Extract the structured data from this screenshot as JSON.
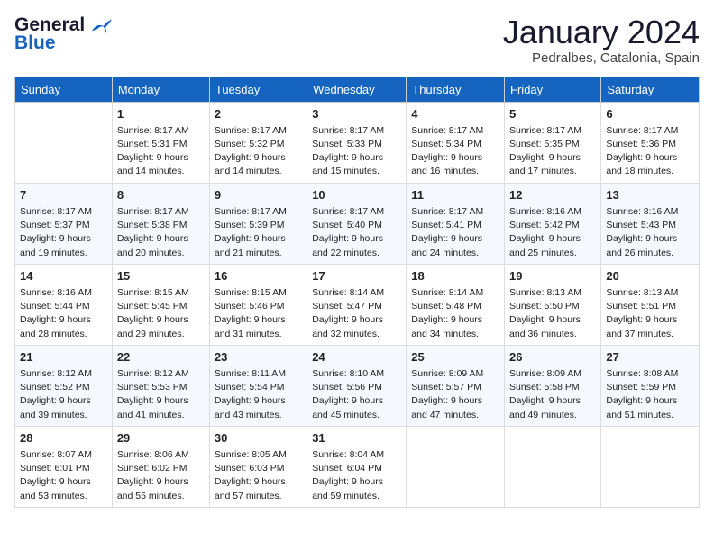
{
  "header": {
    "logo_general": "General",
    "logo_blue": "Blue",
    "month_title": "January 2024",
    "location": "Pedralbes, Catalonia, Spain"
  },
  "weekdays": [
    "Sunday",
    "Monday",
    "Tuesday",
    "Wednesday",
    "Thursday",
    "Friday",
    "Saturday"
  ],
  "weeks": [
    [
      {
        "day": "",
        "sunrise": "",
        "sunset": "",
        "daylight": ""
      },
      {
        "day": "1",
        "sunrise": "Sunrise: 8:17 AM",
        "sunset": "Sunset: 5:31 PM",
        "daylight": "Daylight: 9 hours and 14 minutes."
      },
      {
        "day": "2",
        "sunrise": "Sunrise: 8:17 AM",
        "sunset": "Sunset: 5:32 PM",
        "daylight": "Daylight: 9 hours and 14 minutes."
      },
      {
        "day": "3",
        "sunrise": "Sunrise: 8:17 AM",
        "sunset": "Sunset: 5:33 PM",
        "daylight": "Daylight: 9 hours and 15 minutes."
      },
      {
        "day": "4",
        "sunrise": "Sunrise: 8:17 AM",
        "sunset": "Sunset: 5:34 PM",
        "daylight": "Daylight: 9 hours and 16 minutes."
      },
      {
        "day": "5",
        "sunrise": "Sunrise: 8:17 AM",
        "sunset": "Sunset: 5:35 PM",
        "daylight": "Daylight: 9 hours and 17 minutes."
      },
      {
        "day": "6",
        "sunrise": "Sunrise: 8:17 AM",
        "sunset": "Sunset: 5:36 PM",
        "daylight": "Daylight: 9 hours and 18 minutes."
      }
    ],
    [
      {
        "day": "7",
        "sunrise": "Sunrise: 8:17 AM",
        "sunset": "Sunset: 5:37 PM",
        "daylight": "Daylight: 9 hours and 19 minutes."
      },
      {
        "day": "8",
        "sunrise": "Sunrise: 8:17 AM",
        "sunset": "Sunset: 5:38 PM",
        "daylight": "Daylight: 9 hours and 20 minutes."
      },
      {
        "day": "9",
        "sunrise": "Sunrise: 8:17 AM",
        "sunset": "Sunset: 5:39 PM",
        "daylight": "Daylight: 9 hours and 21 minutes."
      },
      {
        "day": "10",
        "sunrise": "Sunrise: 8:17 AM",
        "sunset": "Sunset: 5:40 PM",
        "daylight": "Daylight: 9 hours and 22 minutes."
      },
      {
        "day": "11",
        "sunrise": "Sunrise: 8:17 AM",
        "sunset": "Sunset: 5:41 PM",
        "daylight": "Daylight: 9 hours and 24 minutes."
      },
      {
        "day": "12",
        "sunrise": "Sunrise: 8:16 AM",
        "sunset": "Sunset: 5:42 PM",
        "daylight": "Daylight: 9 hours and 25 minutes."
      },
      {
        "day": "13",
        "sunrise": "Sunrise: 8:16 AM",
        "sunset": "Sunset: 5:43 PM",
        "daylight": "Daylight: 9 hours and 26 minutes."
      }
    ],
    [
      {
        "day": "14",
        "sunrise": "Sunrise: 8:16 AM",
        "sunset": "Sunset: 5:44 PM",
        "daylight": "Daylight: 9 hours and 28 minutes."
      },
      {
        "day": "15",
        "sunrise": "Sunrise: 8:15 AM",
        "sunset": "Sunset: 5:45 PM",
        "daylight": "Daylight: 9 hours and 29 minutes."
      },
      {
        "day": "16",
        "sunrise": "Sunrise: 8:15 AM",
        "sunset": "Sunset: 5:46 PM",
        "daylight": "Daylight: 9 hours and 31 minutes."
      },
      {
        "day": "17",
        "sunrise": "Sunrise: 8:14 AM",
        "sunset": "Sunset: 5:47 PM",
        "daylight": "Daylight: 9 hours and 32 minutes."
      },
      {
        "day": "18",
        "sunrise": "Sunrise: 8:14 AM",
        "sunset": "Sunset: 5:48 PM",
        "daylight": "Daylight: 9 hours and 34 minutes."
      },
      {
        "day": "19",
        "sunrise": "Sunrise: 8:13 AM",
        "sunset": "Sunset: 5:50 PM",
        "daylight": "Daylight: 9 hours and 36 minutes."
      },
      {
        "day": "20",
        "sunrise": "Sunrise: 8:13 AM",
        "sunset": "Sunset: 5:51 PM",
        "daylight": "Daylight: 9 hours and 37 minutes."
      }
    ],
    [
      {
        "day": "21",
        "sunrise": "Sunrise: 8:12 AM",
        "sunset": "Sunset: 5:52 PM",
        "daylight": "Daylight: 9 hours and 39 minutes."
      },
      {
        "day": "22",
        "sunrise": "Sunrise: 8:12 AM",
        "sunset": "Sunset: 5:53 PM",
        "daylight": "Daylight: 9 hours and 41 minutes."
      },
      {
        "day": "23",
        "sunrise": "Sunrise: 8:11 AM",
        "sunset": "Sunset: 5:54 PM",
        "daylight": "Daylight: 9 hours and 43 minutes."
      },
      {
        "day": "24",
        "sunrise": "Sunrise: 8:10 AM",
        "sunset": "Sunset: 5:56 PM",
        "daylight": "Daylight: 9 hours and 45 minutes."
      },
      {
        "day": "25",
        "sunrise": "Sunrise: 8:09 AM",
        "sunset": "Sunset: 5:57 PM",
        "daylight": "Daylight: 9 hours and 47 minutes."
      },
      {
        "day": "26",
        "sunrise": "Sunrise: 8:09 AM",
        "sunset": "Sunset: 5:58 PM",
        "daylight": "Daylight: 9 hours and 49 minutes."
      },
      {
        "day": "27",
        "sunrise": "Sunrise: 8:08 AM",
        "sunset": "Sunset: 5:59 PM",
        "daylight": "Daylight: 9 hours and 51 minutes."
      }
    ],
    [
      {
        "day": "28",
        "sunrise": "Sunrise: 8:07 AM",
        "sunset": "Sunset: 6:01 PM",
        "daylight": "Daylight: 9 hours and 53 minutes."
      },
      {
        "day": "29",
        "sunrise": "Sunrise: 8:06 AM",
        "sunset": "Sunset: 6:02 PM",
        "daylight": "Daylight: 9 hours and 55 minutes."
      },
      {
        "day": "30",
        "sunrise": "Sunrise: 8:05 AM",
        "sunset": "Sunset: 6:03 PM",
        "daylight": "Daylight: 9 hours and 57 minutes."
      },
      {
        "day": "31",
        "sunrise": "Sunrise: 8:04 AM",
        "sunset": "Sunset: 6:04 PM",
        "daylight": "Daylight: 9 hours and 59 minutes."
      },
      {
        "day": "",
        "sunrise": "",
        "sunset": "",
        "daylight": ""
      },
      {
        "day": "",
        "sunrise": "",
        "sunset": "",
        "daylight": ""
      },
      {
        "day": "",
        "sunrise": "",
        "sunset": "",
        "daylight": ""
      }
    ]
  ]
}
